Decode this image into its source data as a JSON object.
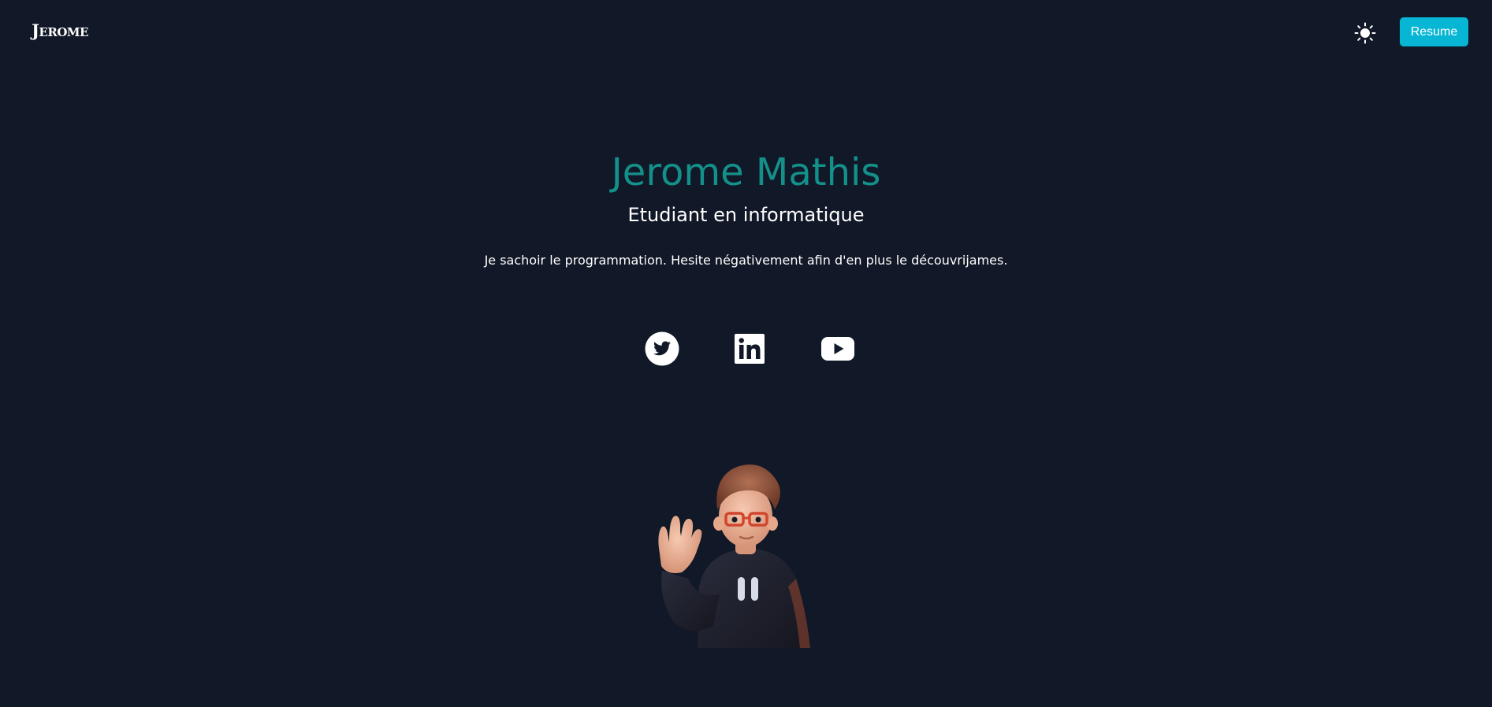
{
  "header": {
    "logo": "Jerome",
    "theme_toggle_icon": "sun-icon",
    "resume_label": "Resume"
  },
  "hero": {
    "name": "Jerome Mathis",
    "subtitle": "Etudiant en informatique",
    "description": "Je sachoir le programmation. Hesite négativement afin d'en plus le découvrijames."
  },
  "social": [
    {
      "name": "twitter",
      "icon": "twitter-icon"
    },
    {
      "name": "linkedin",
      "icon": "linkedin-icon"
    },
    {
      "name": "youtube",
      "icon": "youtube-icon"
    }
  ],
  "colors": {
    "background": "#111827",
    "accent": "#14908a",
    "button": "#06b6d4",
    "text": "#ffffff"
  },
  "illustration": "waving-avatar"
}
